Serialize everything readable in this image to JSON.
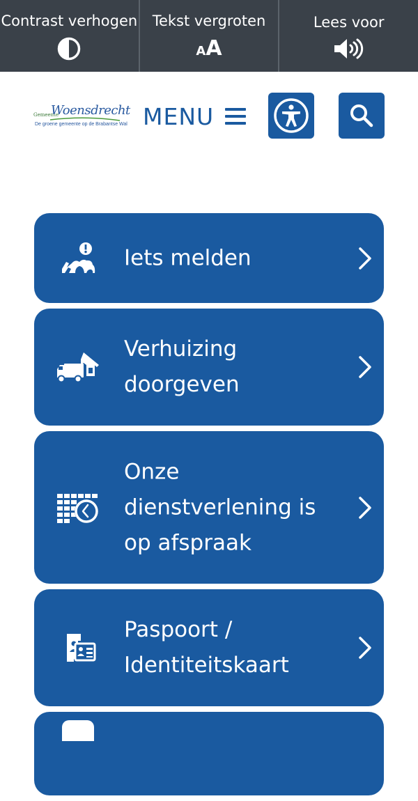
{
  "topbar": {
    "contrast": {
      "label": "Contrast verhogen",
      "icon": "contrast-icon"
    },
    "textsize": {
      "label": "Tekst vergroten",
      "glyph_small": "A",
      "glyph_big": "A",
      "icon": "text-size-icon"
    },
    "readaloud": {
      "label": "Lees voor",
      "icon": "speaker-icon"
    }
  },
  "header": {
    "logo": {
      "prefix": "Gemeente",
      "name": "Woensdrecht",
      "tagline": "De groene gemeente op de Brabantse Wal"
    },
    "menu_label": "MENU",
    "accessibility_icon": "accessibility-icon",
    "search_icon": "search-icon"
  },
  "tiles": [
    {
      "label": "Iets melden",
      "icon": "report-icon"
    },
    {
      "label": "Verhuizing doorgeven",
      "icon": "moving-truck-icon"
    },
    {
      "label": "Onze dienstverlening is op afspraak",
      "icon": "calendar-clock-icon"
    },
    {
      "label": "Paspoort / Identiteitskaart",
      "icon": "id-card-icon"
    }
  ],
  "colors": {
    "topbar_bg": "#3a4149",
    "brand_blue": "#1a5aa0",
    "white": "#ffffff"
  }
}
